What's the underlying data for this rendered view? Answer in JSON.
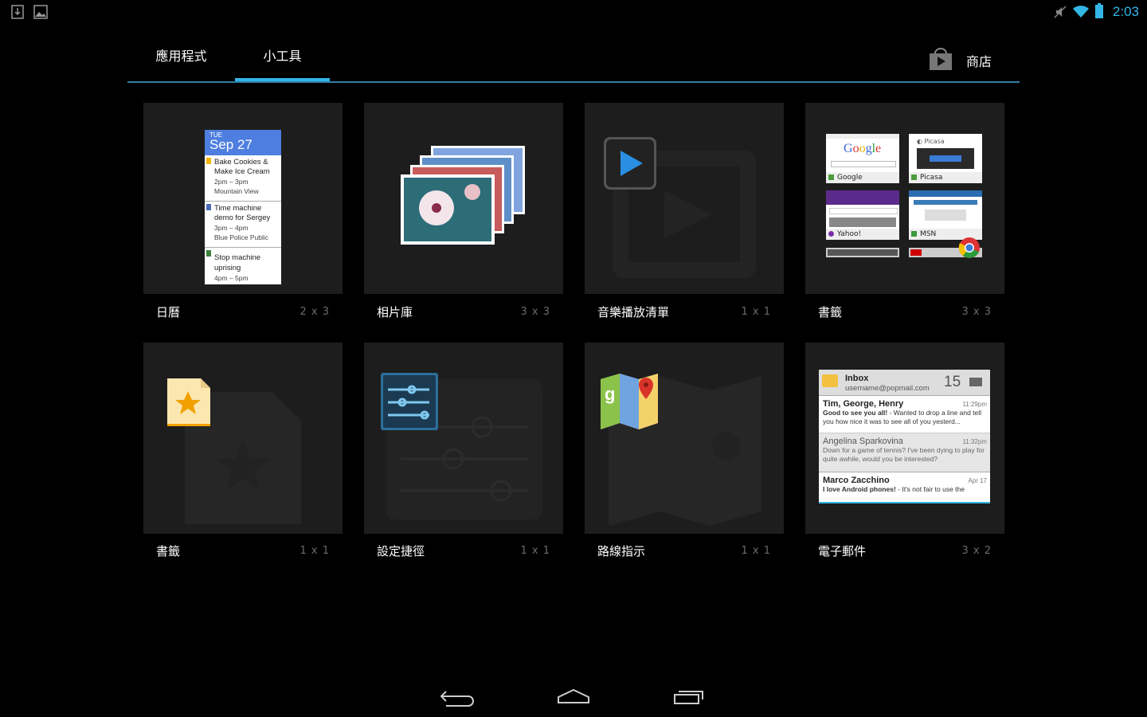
{
  "status_bar": {
    "time": "2:03",
    "left_icons": [
      "download-icon",
      "image-icon"
    ],
    "right_icons": [
      "mute-icon",
      "wifi-icon",
      "battery-icon"
    ],
    "accent_color": "#33b5e5"
  },
  "tabs": [
    {
      "label": "應用程式",
      "selected": false
    },
    {
      "label": "小工具",
      "selected": true
    }
  ],
  "store": {
    "label": "商店",
    "icon": "play-store-icon"
  },
  "widgets": [
    {
      "name": "日曆",
      "size": "2 x 3",
      "preview": "calendar"
    },
    {
      "name": "相片庫",
      "size": "3 x 3",
      "preview": "gallery"
    },
    {
      "name": "音樂播放清單",
      "size": "1 x 1",
      "preview": "music"
    },
    {
      "name": "書籤",
      "size": "3 x 3",
      "preview": "bookmarks-grid"
    },
    {
      "name": "書籤",
      "size": "1 x 1",
      "preview": "bookmark"
    },
    {
      "name": "設定捷徑",
      "size": "1 x 1",
      "preview": "settings"
    },
    {
      "name": "路線指示",
      "size": "1 x 1",
      "preview": "maps"
    },
    {
      "name": "電子郵件",
      "size": "3 x 2",
      "preview": "email"
    }
  ],
  "calendar_preview": {
    "day": "TUE",
    "date": "Sep 27",
    "events": [
      {
        "title1": "Bake Cookies &",
        "title2": "Make Ice Cream",
        "time": "2pm – 3pm",
        "place": "Mountain View",
        "color": "#f4b400"
      },
      {
        "title1": "Time machine",
        "title2": "demo for Sergey",
        "time": "3pm – 4pm",
        "place": "Blue Police Public",
        "color": "#4a6bb5"
      },
      {
        "title1": "Stop machine",
        "title2": "uprising",
        "time": "4pm – 5pm",
        "place": "",
        "color": "#3f7f3f"
      }
    ]
  },
  "bookmarks_preview": [
    {
      "label": "Google"
    },
    {
      "label": "Picasa"
    },
    {
      "label": "Yahoo!"
    },
    {
      "label": "MSN"
    }
  ],
  "email_preview": {
    "header": "Inbox",
    "account": "username@popmail.com",
    "count": "15",
    "messages": [
      {
        "from": "Tim, George, Henry",
        "time": "11:29pm",
        "subject": "Good to see you all!",
        "snippet": " - Wanted to drop a line and tell you how nice it was to see all of you yesterd...",
        "unread": true
      },
      {
        "from": "Angelina Sparkovina",
        "time": "11:32pm",
        "subject": "Down for a game of tennis?",
        "snippet": " I've been dying to play for quite awhile, would you be interested?",
        "unread": false
      },
      {
        "from": "Marco Zacchino",
        "time": "Apr 17",
        "subject": "I love Android phones!",
        "snippet": " -  It's not fair to use the",
        "unread": true
      }
    ]
  },
  "nav_buttons": [
    "back-icon",
    "home-icon",
    "recents-icon"
  ]
}
